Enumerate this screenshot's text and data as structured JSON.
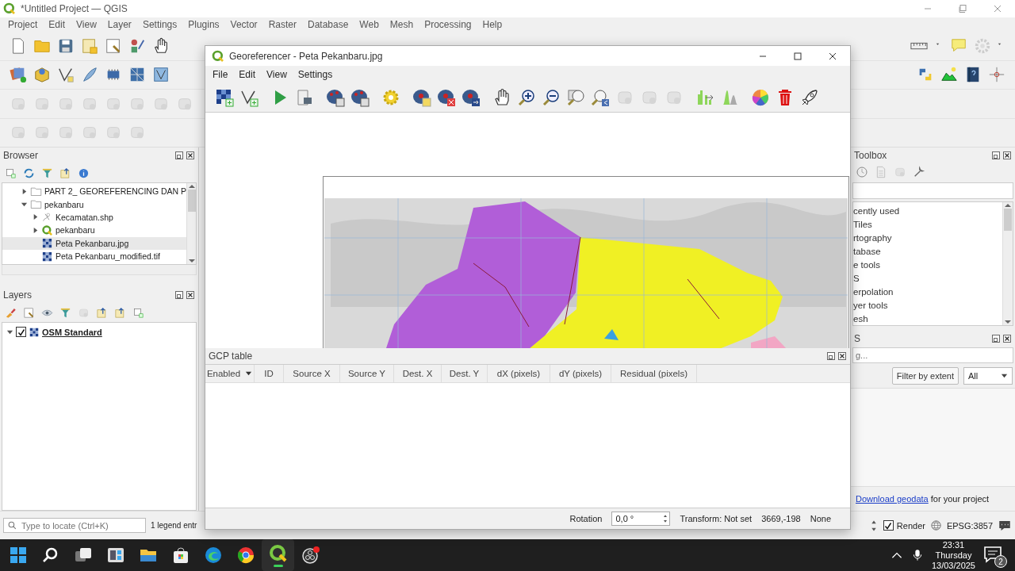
{
  "main_window": {
    "title": "*Untitled Project — QGIS",
    "menu": [
      "Project",
      "Edit",
      "View",
      "Layer",
      "Settings",
      "Plugins",
      "Vector",
      "Raster",
      "Database",
      "Web",
      "Mesh",
      "Processing",
      "Help"
    ]
  },
  "browser": {
    "title": "Browser",
    "tree": [
      {
        "label": "PART 2_ GEOREFERENCING DAN P",
        "kind": "folder",
        "expanded": false,
        "selected": false
      },
      {
        "label": "pekanbaru",
        "kind": "folder",
        "expanded": true,
        "selected": false,
        "children": [
          {
            "label": "Kecamatan.shp",
            "kind": "vector",
            "expanded": false,
            "selected": false
          },
          {
            "label": "pekanbaru",
            "kind": "project",
            "expanded": false,
            "selected": false
          },
          {
            "label": "Peta Pekanbaru.jpg",
            "kind": "raster",
            "selected": true
          },
          {
            "label": "Peta Pekanbaru_modified.tif",
            "kind": "raster",
            "selected": false
          }
        ]
      }
    ]
  },
  "layers": {
    "title": "Layers",
    "items": [
      {
        "label": "OSM Standard",
        "checked": true,
        "expanded": true
      }
    ]
  },
  "toolbox": {
    "title": "Toolbox",
    "items": [
      "cently used",
      "Tiles",
      "rtography",
      "tabase",
      "e tools",
      "S",
      "erpolation",
      "yer tools",
      "esh"
    ]
  },
  "data_source_panel": {
    "title": "S",
    "search": {
      "placeholder": "g..."
    },
    "filter_button": "Filter by extent",
    "dropdown": {
      "value": "All"
    },
    "footer": {
      "link": "Download geodata",
      "text": " for your project"
    }
  },
  "status_bar": {
    "locate": {
      "placeholder": "Type to locate (Ctrl+K)"
    },
    "legend_info": "1 legend entr",
    "render": {
      "label": "Render",
      "checked": true
    },
    "crs": "EPSG:3857"
  },
  "georeferencer": {
    "title": "Georeferencer - Peta Pekanbaru.jpg",
    "menu": [
      "File",
      "Edit",
      "View",
      "Settings"
    ],
    "gcp_table": {
      "title": "GCP table",
      "columns": [
        "Enabled",
        "ID",
        "Source X",
        "Source Y",
        "Dest. X",
        "Dest. Y",
        "dX (pixels)",
        "dY (pixels)",
        "Residual (pixels)"
      ]
    },
    "status_bar": {
      "rotation_label": "Rotation",
      "rotation": {
        "value": "0,0 °"
      },
      "transform": "Transform: Not set",
      "coordinates": "3669,-198",
      "render_mode": "None"
    }
  },
  "taskbar": {
    "apps": [
      {
        "kind": "start",
        "selected": false
      },
      {
        "kind": "search",
        "selected": false
      },
      {
        "kind": "taskview",
        "selected": false
      },
      {
        "kind": "widgets",
        "selected": false
      },
      {
        "kind": "explorer",
        "selected": false
      },
      {
        "kind": "store",
        "selected": false
      },
      {
        "kind": "edge",
        "selected": false
      },
      {
        "kind": "chrome",
        "selected": false
      },
      {
        "kind": "qgis",
        "selected": true
      },
      {
        "kind": "obs",
        "selected": false
      }
    ],
    "clock": {
      "time": "23:31",
      "day": "Thursday",
      "date": "13/03/2025"
    },
    "notifications": {
      "count": "2"
    }
  }
}
